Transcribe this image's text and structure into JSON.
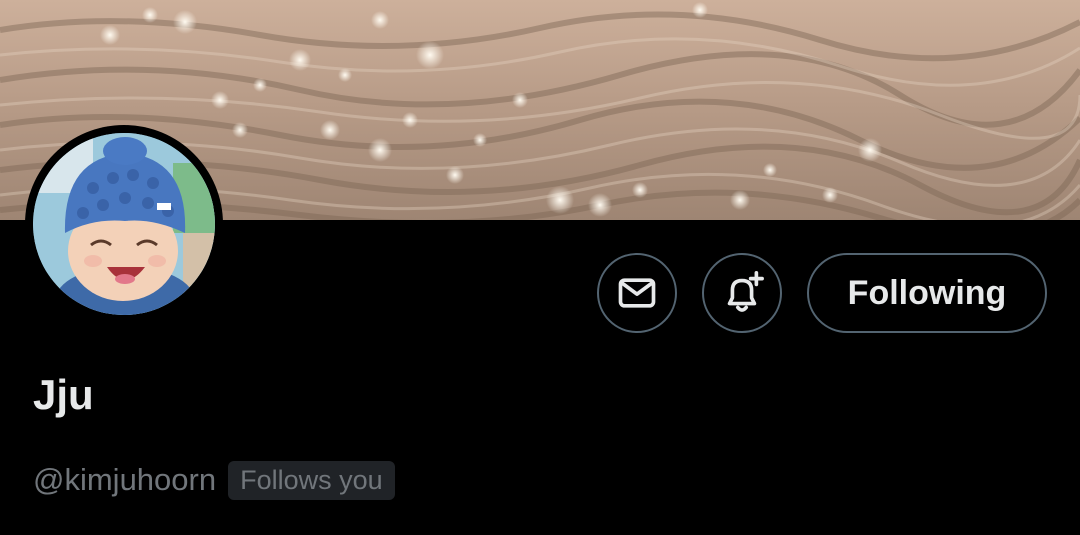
{
  "profile": {
    "display_name": "Jju",
    "handle": "@kimjuhoorn",
    "follows_you_label": "Follows you"
  },
  "actions": {
    "message_icon": "envelope-icon",
    "notify_icon": "bell-plus-icon",
    "follow_label": "Following"
  },
  "colors": {
    "background": "#000000",
    "text_primary": "#e7e9ea",
    "text_secondary": "#71767b",
    "button_border": "#536471",
    "badge_background": "#202327"
  }
}
